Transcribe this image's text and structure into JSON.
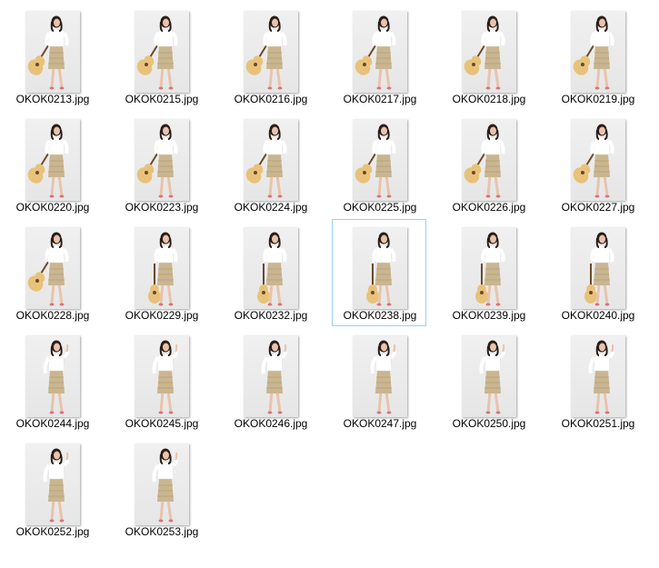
{
  "files": [
    {
      "name": "OKOK0213.jpg",
      "pose": "guitar-side"
    },
    {
      "name": "OKOK0215.jpg",
      "pose": "guitar-side"
    },
    {
      "name": "OKOK0216.jpg",
      "pose": "guitar-side"
    },
    {
      "name": "OKOK0217.jpg",
      "pose": "guitar-side"
    },
    {
      "name": "OKOK0218.jpg",
      "pose": "guitar-side"
    },
    {
      "name": "OKOK0219.jpg",
      "pose": "guitar-side"
    },
    {
      "name": "OKOK0220.jpg",
      "pose": "guitar-side"
    },
    {
      "name": "OKOK0223.jpg",
      "pose": "guitar-side"
    },
    {
      "name": "OKOK0224.jpg",
      "pose": "guitar-side"
    },
    {
      "name": "OKOK0225.jpg",
      "pose": "guitar-side"
    },
    {
      "name": "OKOK0226.jpg",
      "pose": "guitar-side"
    },
    {
      "name": "OKOK0227.jpg",
      "pose": "guitar-side"
    },
    {
      "name": "OKOK0228.jpg",
      "pose": "guitar-side"
    },
    {
      "name": "OKOK0229.jpg",
      "pose": "guitar-down"
    },
    {
      "name": "OKOK0232.jpg",
      "pose": "guitar-down"
    },
    {
      "name": "OKOK0238.jpg",
      "pose": "guitar-down"
    },
    {
      "name": "OKOK0239.jpg",
      "pose": "guitar-down"
    },
    {
      "name": "OKOK0240.jpg",
      "pose": "guitar-down"
    },
    {
      "name": "OKOK0244.jpg",
      "pose": "standing"
    },
    {
      "name": "OKOK0245.jpg",
      "pose": "standing"
    },
    {
      "name": "OKOK0246.jpg",
      "pose": "standing"
    },
    {
      "name": "OKOK0247.jpg",
      "pose": "standing"
    },
    {
      "name": "OKOK0250.jpg",
      "pose": "standing"
    },
    {
      "name": "OKOK0251.jpg",
      "pose": "standing"
    },
    {
      "name": "OKOK0252.jpg",
      "pose": "standing"
    },
    {
      "name": "OKOK0253.jpg",
      "pose": "standing"
    }
  ],
  "hovered_file": "OKOK0238.jpg",
  "colors": {
    "hover_border": "#99d1ff",
    "skirt": "#c9b690",
    "blouse": "#ffffff",
    "hair": "#2b1d17",
    "skin": "#e9c3ac",
    "guitar": "#e8c27a",
    "guitar_dark": "#6b4a2a",
    "shoes": "#d4767a"
  }
}
